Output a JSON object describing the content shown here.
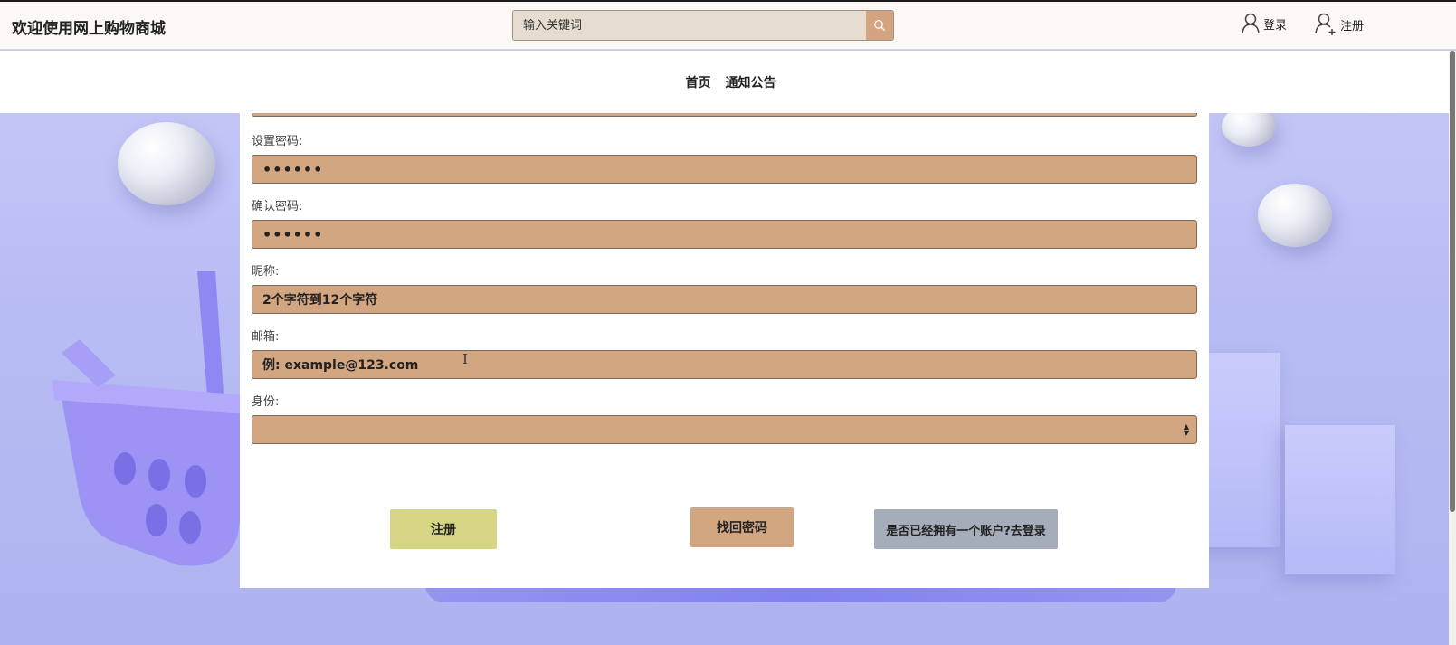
{
  "header": {
    "site_title": "欢迎使用网上购物商城",
    "search_placeholder": "输入关键词",
    "login_label": "登录",
    "register_label": "注册"
  },
  "nav": {
    "items": [
      "首页",
      "通知公告"
    ]
  },
  "form": {
    "fields": [
      {
        "label": "设置密码:",
        "value": "••••••"
      },
      {
        "label": "确认密码:",
        "value": "••••••"
      },
      {
        "label": "昵称:",
        "value": "2个字符到12个字符"
      },
      {
        "label": "邮箱:",
        "value": "例: example@123.com"
      },
      {
        "label": "身份:",
        "value": ""
      }
    ],
    "buttons": {
      "register": "注册",
      "find_password": "找回密码",
      "go_login": "是否已经拥有一个账户?去登录"
    }
  },
  "colors": {
    "input_bg": "#d3a682",
    "register_btn": "#d5d585",
    "login_btn": "#a6adba",
    "header_bg": "#fdf8f5"
  }
}
